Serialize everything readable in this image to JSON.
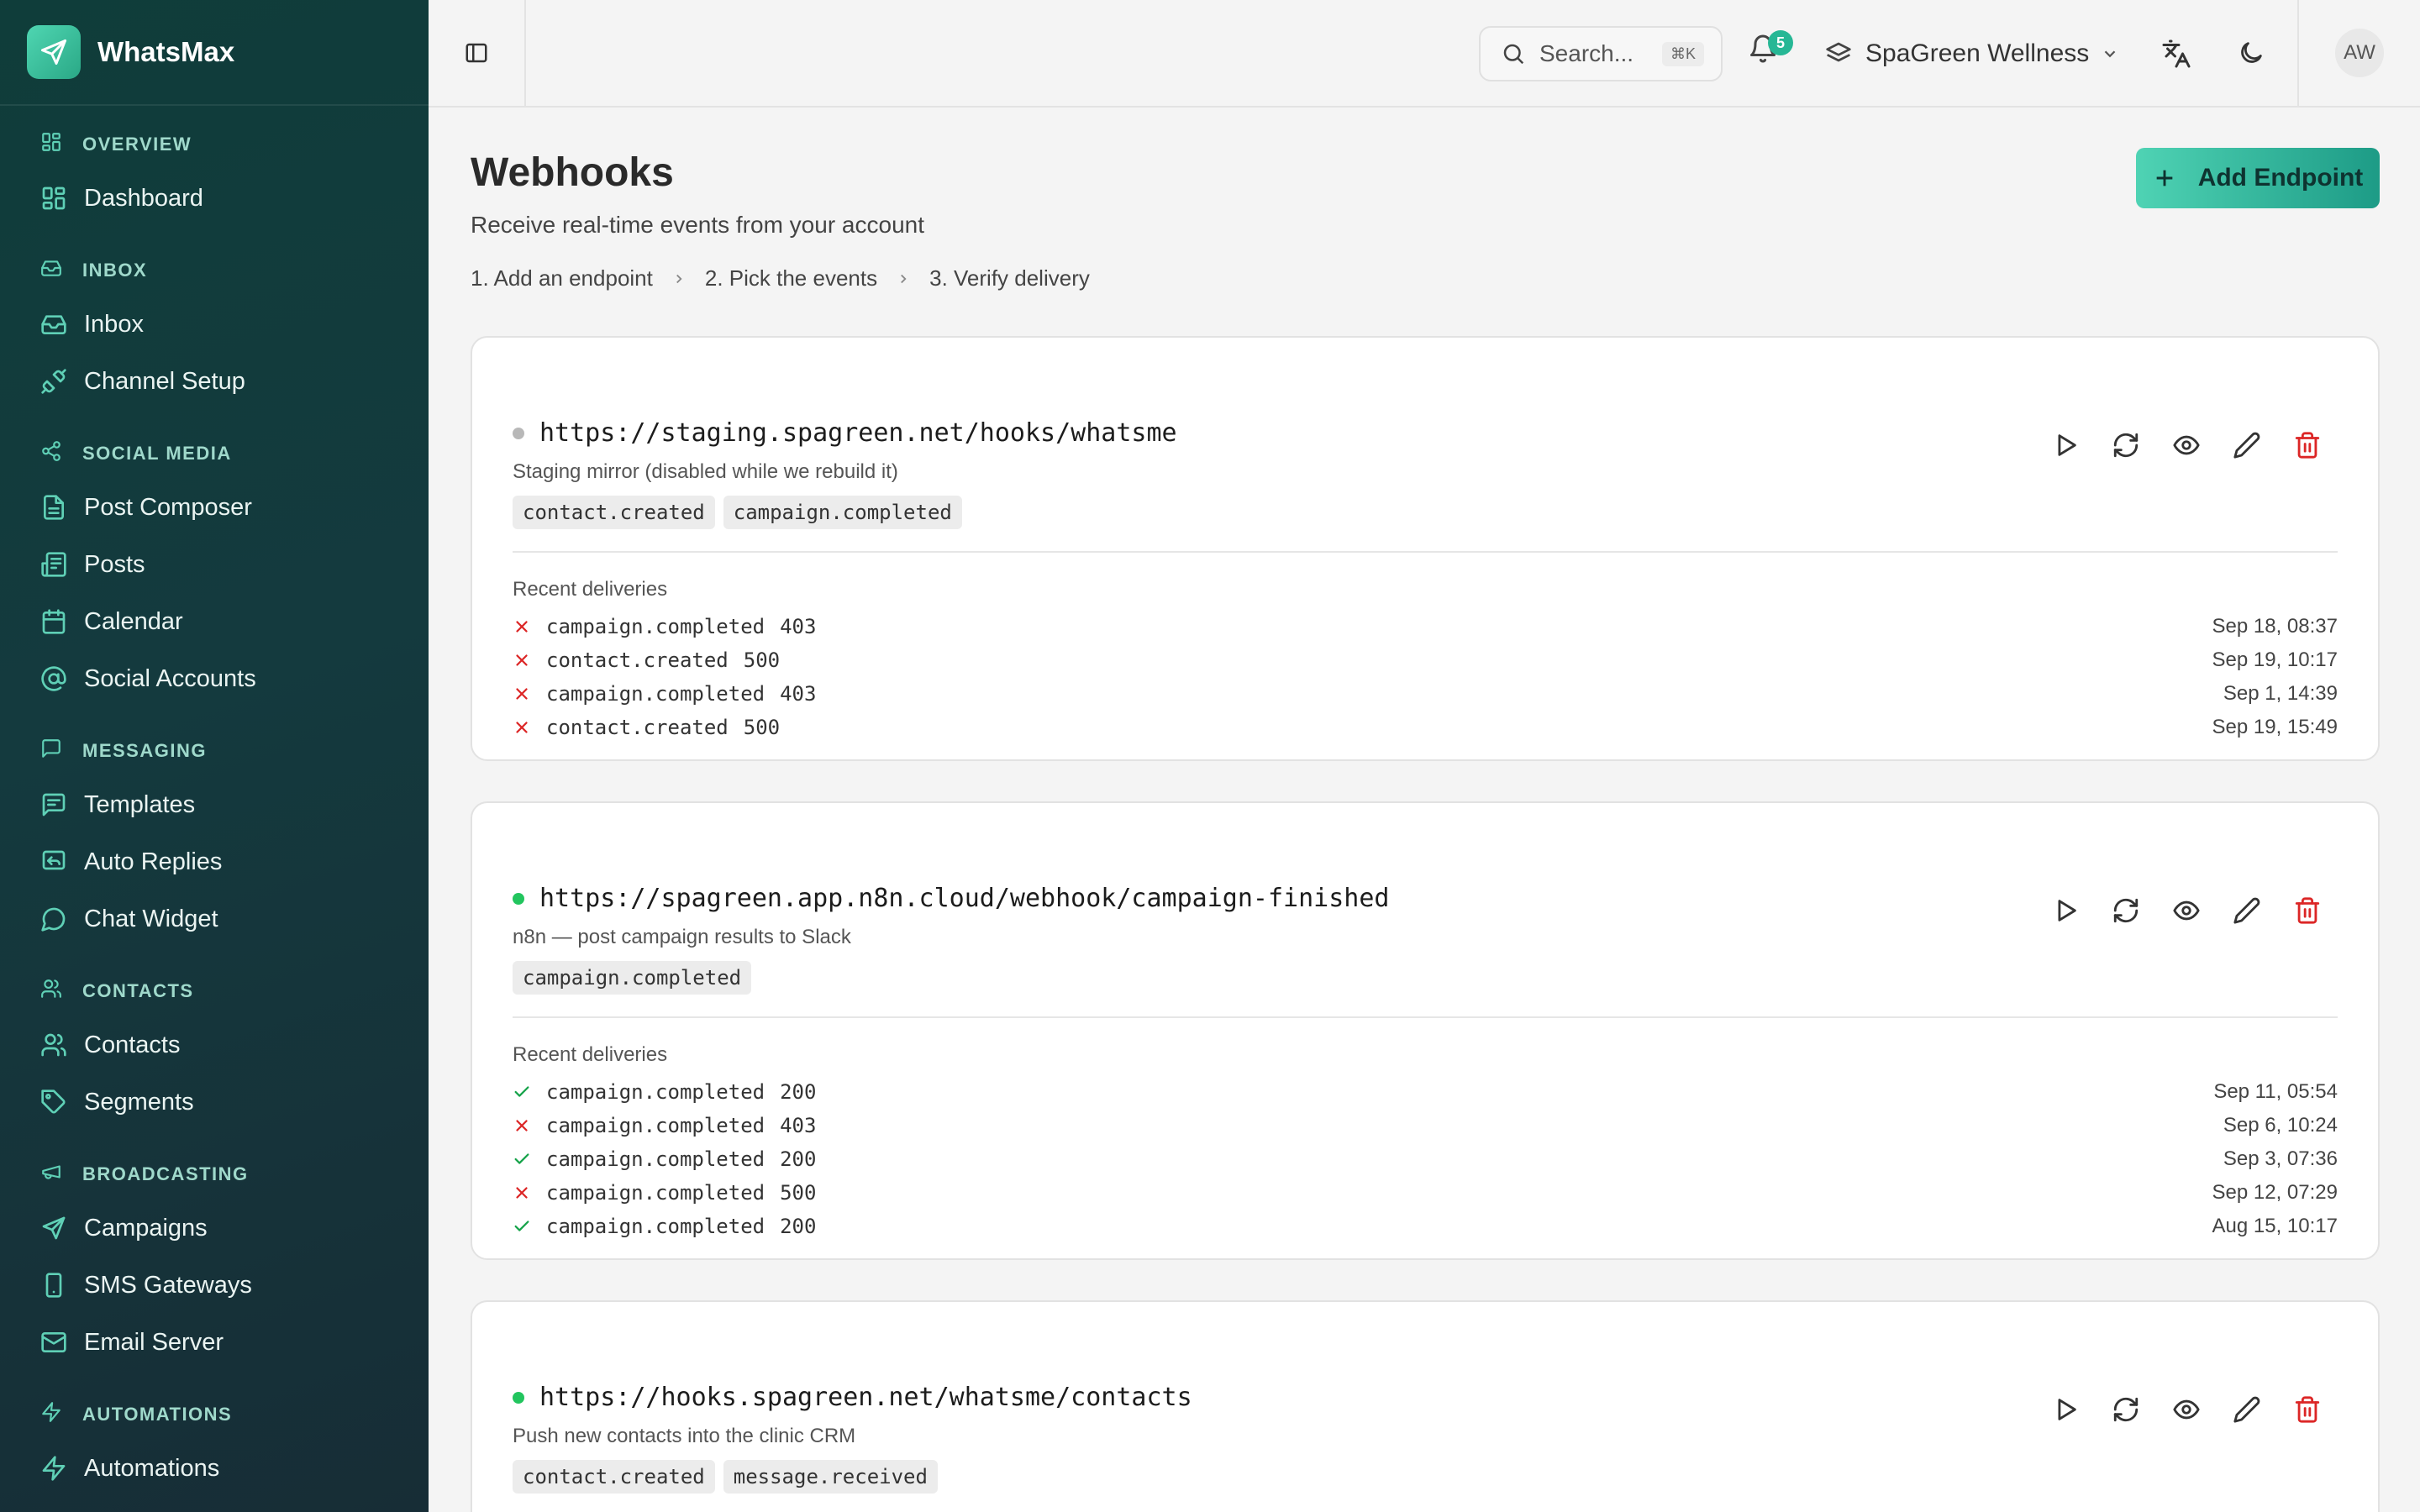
{
  "app": {
    "name": "WhatsMax"
  },
  "sidebar": {
    "sections": [
      {
        "title": "OVERVIEW",
        "items": [
          {
            "label": "Dashboard"
          }
        ]
      },
      {
        "title": "INBOX",
        "items": [
          {
            "label": "Inbox"
          },
          {
            "label": "Channel Setup"
          }
        ]
      },
      {
        "title": "SOCIAL MEDIA",
        "items": [
          {
            "label": "Post Composer"
          },
          {
            "label": "Posts"
          },
          {
            "label": "Calendar"
          },
          {
            "label": "Social Accounts"
          }
        ]
      },
      {
        "title": "MESSAGING",
        "items": [
          {
            "label": "Templates"
          },
          {
            "label": "Auto Replies"
          },
          {
            "label": "Chat Widget"
          }
        ]
      },
      {
        "title": "CONTACTS",
        "items": [
          {
            "label": "Contacts"
          },
          {
            "label": "Segments"
          }
        ]
      },
      {
        "title": "BROADCASTING",
        "items": [
          {
            "label": "Campaigns"
          },
          {
            "label": "SMS Gateways"
          },
          {
            "label": "Email Server"
          }
        ]
      },
      {
        "title": "AUTOMATIONS",
        "items": [
          {
            "label": "Automations"
          }
        ]
      }
    ]
  },
  "header": {
    "search_placeholder": "Search...",
    "search_shortcut": "⌘K",
    "notification_count": "5",
    "workspace": "SpaGreen Wellness",
    "avatar_initials": "AW"
  },
  "page": {
    "title": "Webhooks",
    "subtitle": "Receive real-time events from your account",
    "add_button": "Add Endpoint",
    "steps": [
      "1.  Add an endpoint",
      "2.  Pick the events",
      "3.  Verify delivery"
    ]
  },
  "colors": {
    "success": "#16a34a",
    "error": "#dc2626",
    "active_dot": "#22c55e",
    "inactive_dot": "#b8b8b8",
    "accent": "#26b795"
  },
  "recent_label": "Recent deliveries",
  "endpoints": [
    {
      "url": "https://staging.spagreen.net/hooks/whatsme",
      "description": "Staging mirror (disabled while we rebuild it)",
      "active": false,
      "events": [
        "contact.created",
        "campaign.completed"
      ],
      "deliveries": [
        {
          "event": "campaign.completed",
          "code": "403",
          "ok": false,
          "time": "Sep 18, 08:37"
        },
        {
          "event": "contact.created",
          "code": "500",
          "ok": false,
          "time": "Sep 19, 10:17"
        },
        {
          "event": "campaign.completed",
          "code": "403",
          "ok": false,
          "time": "Sep 1, 14:39"
        },
        {
          "event": "contact.created",
          "code": "500",
          "ok": false,
          "time": "Sep 19, 15:49"
        }
      ]
    },
    {
      "url": "https://spagreen.app.n8n.cloud/webhook/campaign-finished",
      "description": "n8n — post campaign results to Slack",
      "active": true,
      "events": [
        "campaign.completed"
      ],
      "deliveries": [
        {
          "event": "campaign.completed",
          "code": "200",
          "ok": true,
          "time": "Sep 11, 05:54"
        },
        {
          "event": "campaign.completed",
          "code": "403",
          "ok": false,
          "time": "Sep 6, 10:24"
        },
        {
          "event": "campaign.completed",
          "code": "200",
          "ok": true,
          "time": "Sep 3, 07:36"
        },
        {
          "event": "campaign.completed",
          "code": "500",
          "ok": false,
          "time": "Sep 12, 07:29"
        },
        {
          "event": "campaign.completed",
          "code": "200",
          "ok": true,
          "time": "Aug 15, 10:17"
        }
      ]
    },
    {
      "url": "https://hooks.spagreen.net/whatsme/contacts",
      "description": "Push new contacts into the clinic CRM",
      "active": true,
      "events": [
        "contact.created",
        "message.received"
      ],
      "deliveries": []
    }
  ]
}
